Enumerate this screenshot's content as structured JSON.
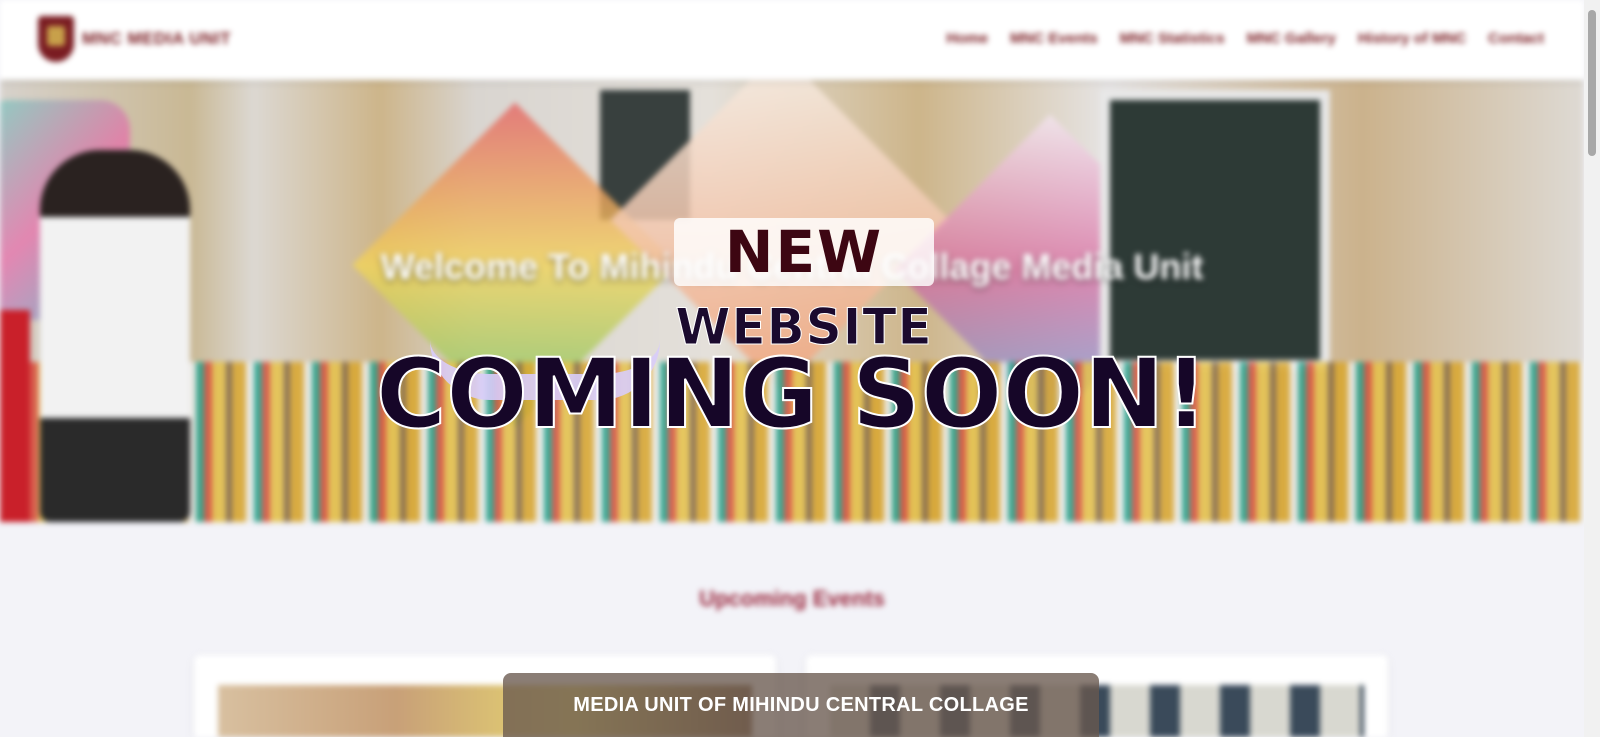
{
  "navbar": {
    "brand": "MNC MEDIA UNIT",
    "links": [
      "Home",
      "MNC Events",
      "MNC Statistics",
      "MNC Gallery",
      "History of MNC",
      "Contact"
    ]
  },
  "hero": {
    "title": "Welcome To Mihindu Central Collage Media Unit"
  },
  "sections": {
    "upcoming_title": "Upcoming Events"
  },
  "overlay": {
    "new": "NEW",
    "website": "WEBSITE",
    "coming_soon": "COMING SOON!",
    "footer_banner": "MEDIA UNIT OF MIHINDU CENTRAL COLLAGE"
  },
  "colors": {
    "brand": "#7a1c22",
    "overlay_text": "#160628",
    "swoosh": "#d9cdfa"
  }
}
